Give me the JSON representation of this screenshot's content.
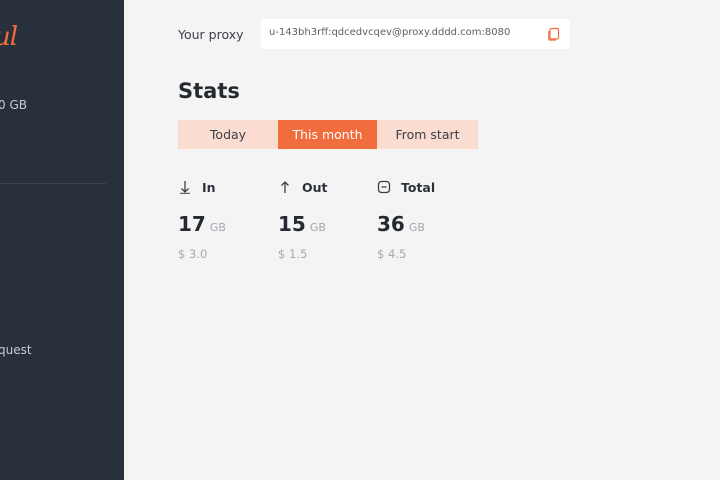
{
  "sidebar": {
    "logo_text": "ul",
    "quota_text": "0 GB",
    "request_text": "quest"
  },
  "proxy": {
    "label": "Your proxy",
    "value": "u-143bh3rff:qdcedvcqev@proxy.dddd.com:8080"
  },
  "stats": {
    "title": "Stats",
    "tabs": [
      {
        "label": "Today",
        "active": false
      },
      {
        "label": "This month",
        "active": true
      },
      {
        "label": "From start",
        "active": false
      }
    ],
    "columns": [
      {
        "label": "In",
        "icon": "arrow-down-icon",
        "value": "17",
        "unit": "GB",
        "cost": "$ 3.0"
      },
      {
        "label": "Out",
        "icon": "arrow-up-icon",
        "value": "15",
        "unit": "GB",
        "cost": "$ 1.5"
      },
      {
        "label": "Total",
        "icon": "total-icon",
        "value": "36",
        "unit": "GB",
        "cost": "$ 4.5"
      }
    ]
  },
  "colors": {
    "accent": "#f26d3d",
    "accent_light": "#fbdcd0",
    "sidebar_bg": "#27303b",
    "page_bg": "#f4f4f5"
  }
}
